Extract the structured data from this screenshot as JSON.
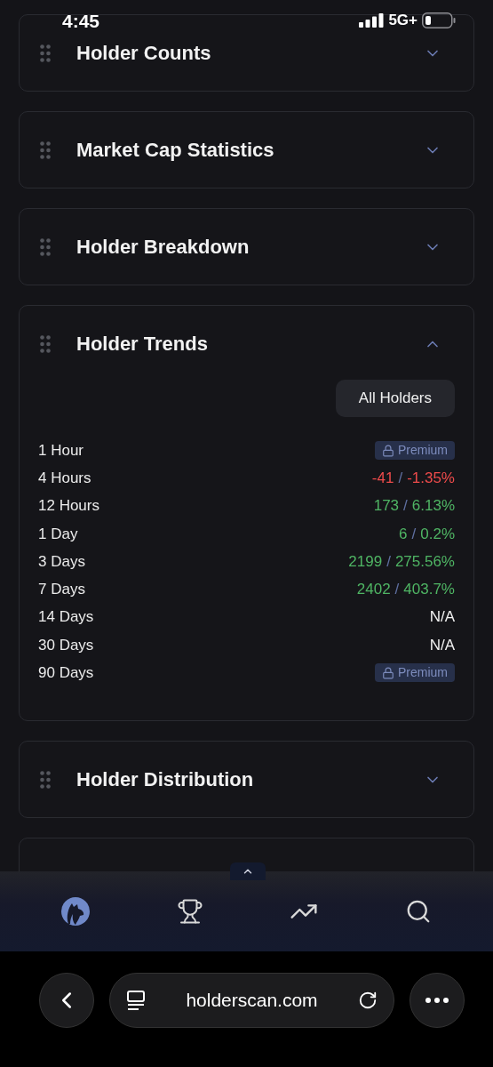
{
  "status_bar": {
    "time": "4:45",
    "network": "5G+"
  },
  "sections": [
    {
      "title": "Holder Counts",
      "expanded": false
    },
    {
      "title": "Market Cap Statistics",
      "expanded": false
    },
    {
      "title": "Holder Breakdown",
      "expanded": false
    },
    {
      "title": "Holder Trends",
      "expanded": true,
      "filter_button": "All Holders",
      "rows": [
        {
          "label": "1 Hour",
          "kind": "premium",
          "badge": "Premium"
        },
        {
          "label": "4 Hours",
          "kind": "change",
          "color": "#ee4b4b",
          "count": "-41",
          "separator": "/",
          "percent": "-1.35%"
        },
        {
          "label": "12 Hours",
          "kind": "change",
          "color": "#4fb564",
          "count": "173",
          "separator": "/",
          "percent": "6.13%"
        },
        {
          "label": "1 Day",
          "kind": "change",
          "color": "#4fb564",
          "count": "6",
          "separator": "/",
          "percent": "0.2%"
        },
        {
          "label": "3 Days",
          "kind": "change",
          "color": "#4fb564",
          "count": "2199",
          "separator": "/",
          "percent": "275.56%"
        },
        {
          "label": "7 Days",
          "kind": "change",
          "color": "#4fb564",
          "count": "2402",
          "separator": "/",
          "percent": "403.7%"
        },
        {
          "label": "14 Days",
          "kind": "na",
          "value": "N/A"
        },
        {
          "label": "30 Days",
          "kind": "na",
          "value": "N/A"
        },
        {
          "label": "90 Days",
          "kind": "premium",
          "badge": "Premium"
        }
      ]
    },
    {
      "title": "Holder Distribution",
      "expanded": false
    }
  ],
  "bottom_nav": [
    {
      "kind": "logo",
      "selected": true
    },
    {
      "kind": "trophy",
      "selected": false
    },
    {
      "kind": "trend",
      "selected": false
    },
    {
      "kind": "search",
      "selected": false
    }
  ],
  "browser_bar": {
    "url": "holderscan.com"
  }
}
